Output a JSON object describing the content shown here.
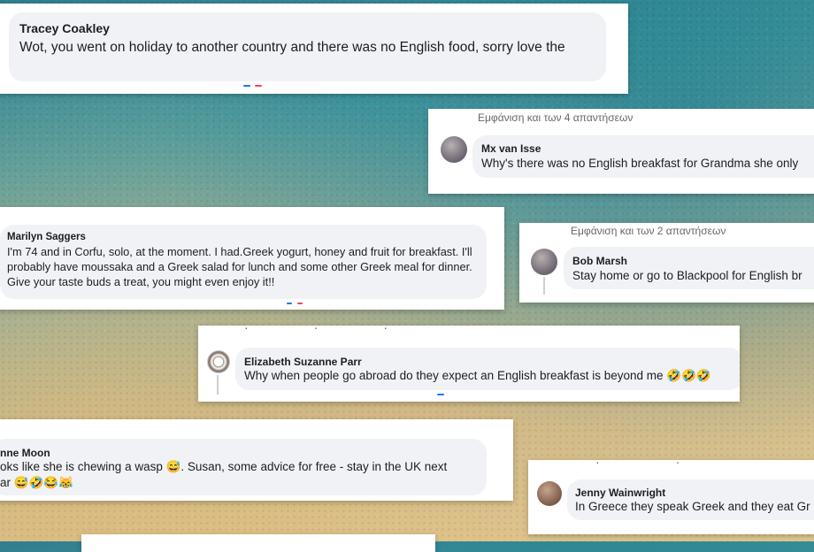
{
  "comments": [
    {
      "name": "Tracey Coakley",
      "text": "Wot, you went on holiday to another country and there was no English food, sorry love the"
    },
    {
      "header": "Εμφάνιση και των 4 απαντήσεων",
      "name": "Mx van Isse",
      "text": "Why's there was no English breakfast for Grandma she only"
    },
    {
      "name": "Marilyn Saggers",
      "text": "I'm 74 and in Corfu, solo, at the moment. I had.Greek yogurt, honey and fruit for breakfast. I'll probably have moussaka and a Greek salad for lunch and some other Greek meal for dinner. Give your taste buds a treat, you might even enjoy it!!"
    },
    {
      "header": "Εμφάνιση και των 2 απαντήσεων",
      "name": "Bob Marsh",
      "text": "Stay home or go to Blackpool for English br"
    },
    {
      "name": "Elizabeth Suzanne Parr",
      "text": "Why when people go abroad do they expect an English breakfast is beyond me 🤣🤣🤣"
    },
    {
      "name": "nne Moon",
      "text": "oks like she is chewing a wasp 😅. Susan, some advice for free - stay in the UK next",
      "text2": "ar 😅🤣😂😹"
    },
    {
      "name": "Jenny Wainwright",
      "text": "In Greece they speak Greek and they eat Gr"
    }
  ],
  "colors": {
    "bubble": "#f0f2f5",
    "text": "#1c1e21",
    "accent_blue": "#1877f2",
    "accent_pink": "#f3425f"
  }
}
